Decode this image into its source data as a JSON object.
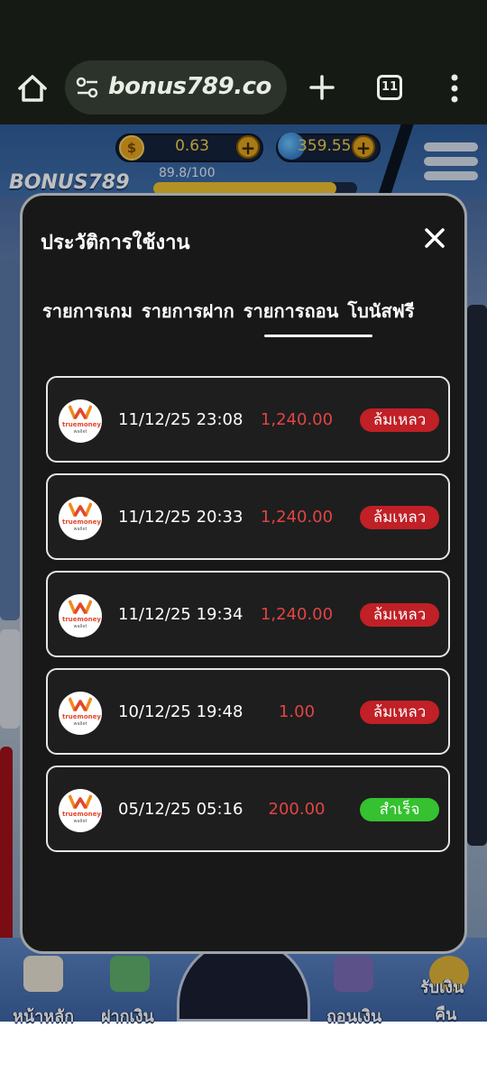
{
  "browser": {
    "url": "bonus789.co",
    "tab_count": "11"
  },
  "game_header": {
    "coin_balance": "0.63",
    "coin_symbol": "$",
    "gem_balance": "359.55",
    "brand": "BONUS789",
    "level_text": "89.8/100",
    "level_progress": 0.898
  },
  "bottom_nav": {
    "home": "หน้าหลัก",
    "deposit": "ฝากเงิน",
    "withdraw": "ถอนเงิน",
    "cashback_line1": "รับเงิน",
    "cashback_line2": "คืน"
  },
  "modal": {
    "title": "ประวัติการใช้งาน",
    "tabs": [
      {
        "label": "รายการเกม",
        "active": false
      },
      {
        "label": "รายการฝาก",
        "active": false
      },
      {
        "label": "รายการถอน",
        "active": true
      },
      {
        "label": "โบนัสฟรี",
        "active": false
      }
    ],
    "wallet_logo": {
      "line1": "truemoney",
      "line2": "wallet"
    },
    "transactions": [
      {
        "datetime": "11/12/25 23:08",
        "amount": "1,240.00",
        "status": "ล้มเหลว",
        "status_type": "fail"
      },
      {
        "datetime": "11/12/25 20:33",
        "amount": "1,240.00",
        "status": "ล้มเหลว",
        "status_type": "fail"
      },
      {
        "datetime": "11/12/25 19:34",
        "amount": "1,240.00",
        "status": "ล้มเหลว",
        "status_type": "fail"
      },
      {
        "datetime": "10/12/25 19:48",
        "amount": "1.00",
        "status": "ล้มเหลว",
        "status_type": "fail"
      },
      {
        "datetime": "05/12/25 05:16",
        "amount": "200.00",
        "status": "สำเร็จ",
        "status_type": "success"
      }
    ]
  },
  "colors": {
    "fail": "#c02026",
    "success": "#35c130",
    "amount": "#e24444",
    "modal_bg": "#181818"
  }
}
